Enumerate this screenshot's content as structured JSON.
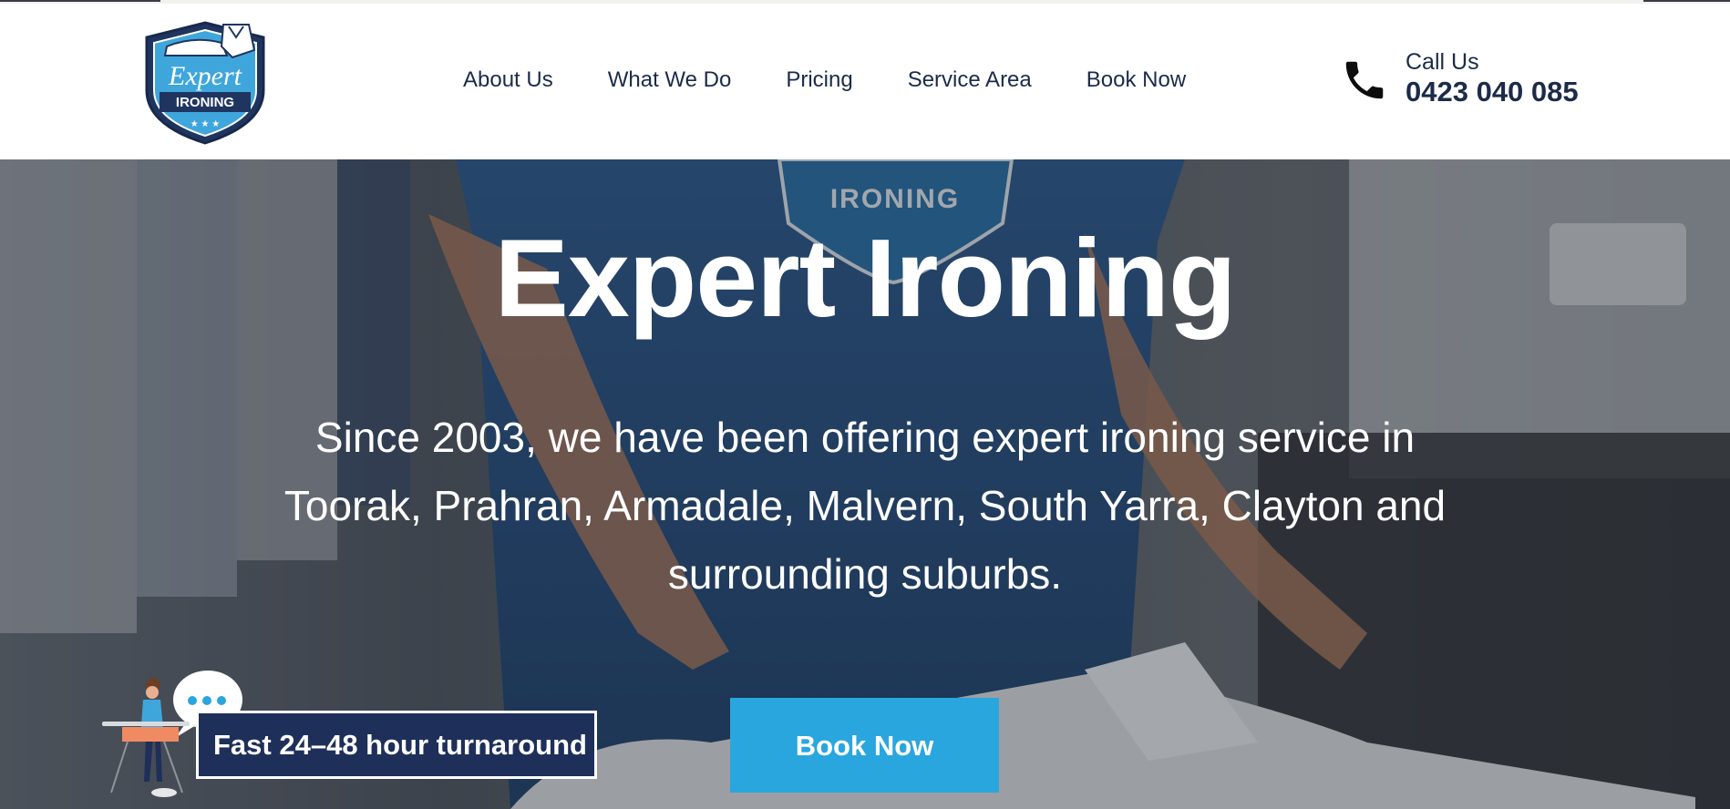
{
  "header": {
    "logo": {
      "script_text": "Expert",
      "banner_text": "IRONING"
    },
    "nav": [
      {
        "label": "About Us"
      },
      {
        "label": "What We Do"
      },
      {
        "label": "Pricing"
      },
      {
        "label": "Service Area"
      },
      {
        "label": "Book Now"
      }
    ],
    "contact": {
      "icon": "phone-icon",
      "label": "Call Us",
      "phone": "0423 040 085"
    }
  },
  "hero": {
    "title": "Expert Ironing",
    "subtitle": "Since 2003, we have been offering expert ironing service in Toorak, Prahran, Armadale, Malvern, South Yarra, Clayton and surrounding suburbs.",
    "badge": "Fast 24–48 hour turnaround",
    "cta": "Book Now",
    "shirt_print": "IRONING"
  },
  "colors": {
    "navy": "#1c2b4a",
    "accent": "#2aa6df",
    "badge_bg": "#1e2f5a"
  }
}
